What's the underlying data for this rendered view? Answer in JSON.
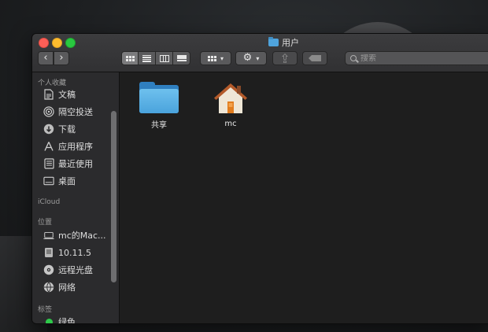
{
  "window": {
    "title": "用户",
    "search_placeholder": "搜索"
  },
  "toolbar": {
    "back_icon": "chevron-left-icon",
    "forward_icon": "chevron-right-icon",
    "view_modes": [
      "icon",
      "list",
      "column",
      "cover-flow"
    ],
    "active_view": "icon"
  },
  "sidebar": {
    "favorites_header": "个人收藏",
    "favorites": [
      {
        "label": "文稿",
        "icon": "document-icon"
      },
      {
        "label": "隔空投送",
        "icon": "airdrop-icon"
      },
      {
        "label": "下载",
        "icon": "download-icon"
      },
      {
        "label": "应用程序",
        "icon": "applications-icon"
      },
      {
        "label": "最近使用",
        "icon": "recents-icon"
      },
      {
        "label": "桌面",
        "icon": "desktop-icon"
      }
    ],
    "icloud_header": "iCloud",
    "devices_header": "位置",
    "devices": [
      {
        "label": "mc的Mac...",
        "icon": "laptop-icon"
      },
      {
        "label": "10.11.5",
        "icon": "disk-icon"
      },
      {
        "label": "远程光盘",
        "icon": "optical-disc-icon"
      },
      {
        "label": "网络",
        "icon": "network-icon"
      }
    ],
    "tags_header": "标签",
    "tags": [
      {
        "label": "绿色",
        "color": "#2ec94a"
      }
    ]
  },
  "content": {
    "items": [
      {
        "label": "共享",
        "icon": "folder-icon"
      },
      {
        "label": "mc",
        "icon": "home-icon"
      }
    ]
  },
  "colors": {
    "close": "#fc5f57",
    "minimize": "#fdbc2e",
    "maximize": "#29c840",
    "folder": "#4aa3dc"
  }
}
